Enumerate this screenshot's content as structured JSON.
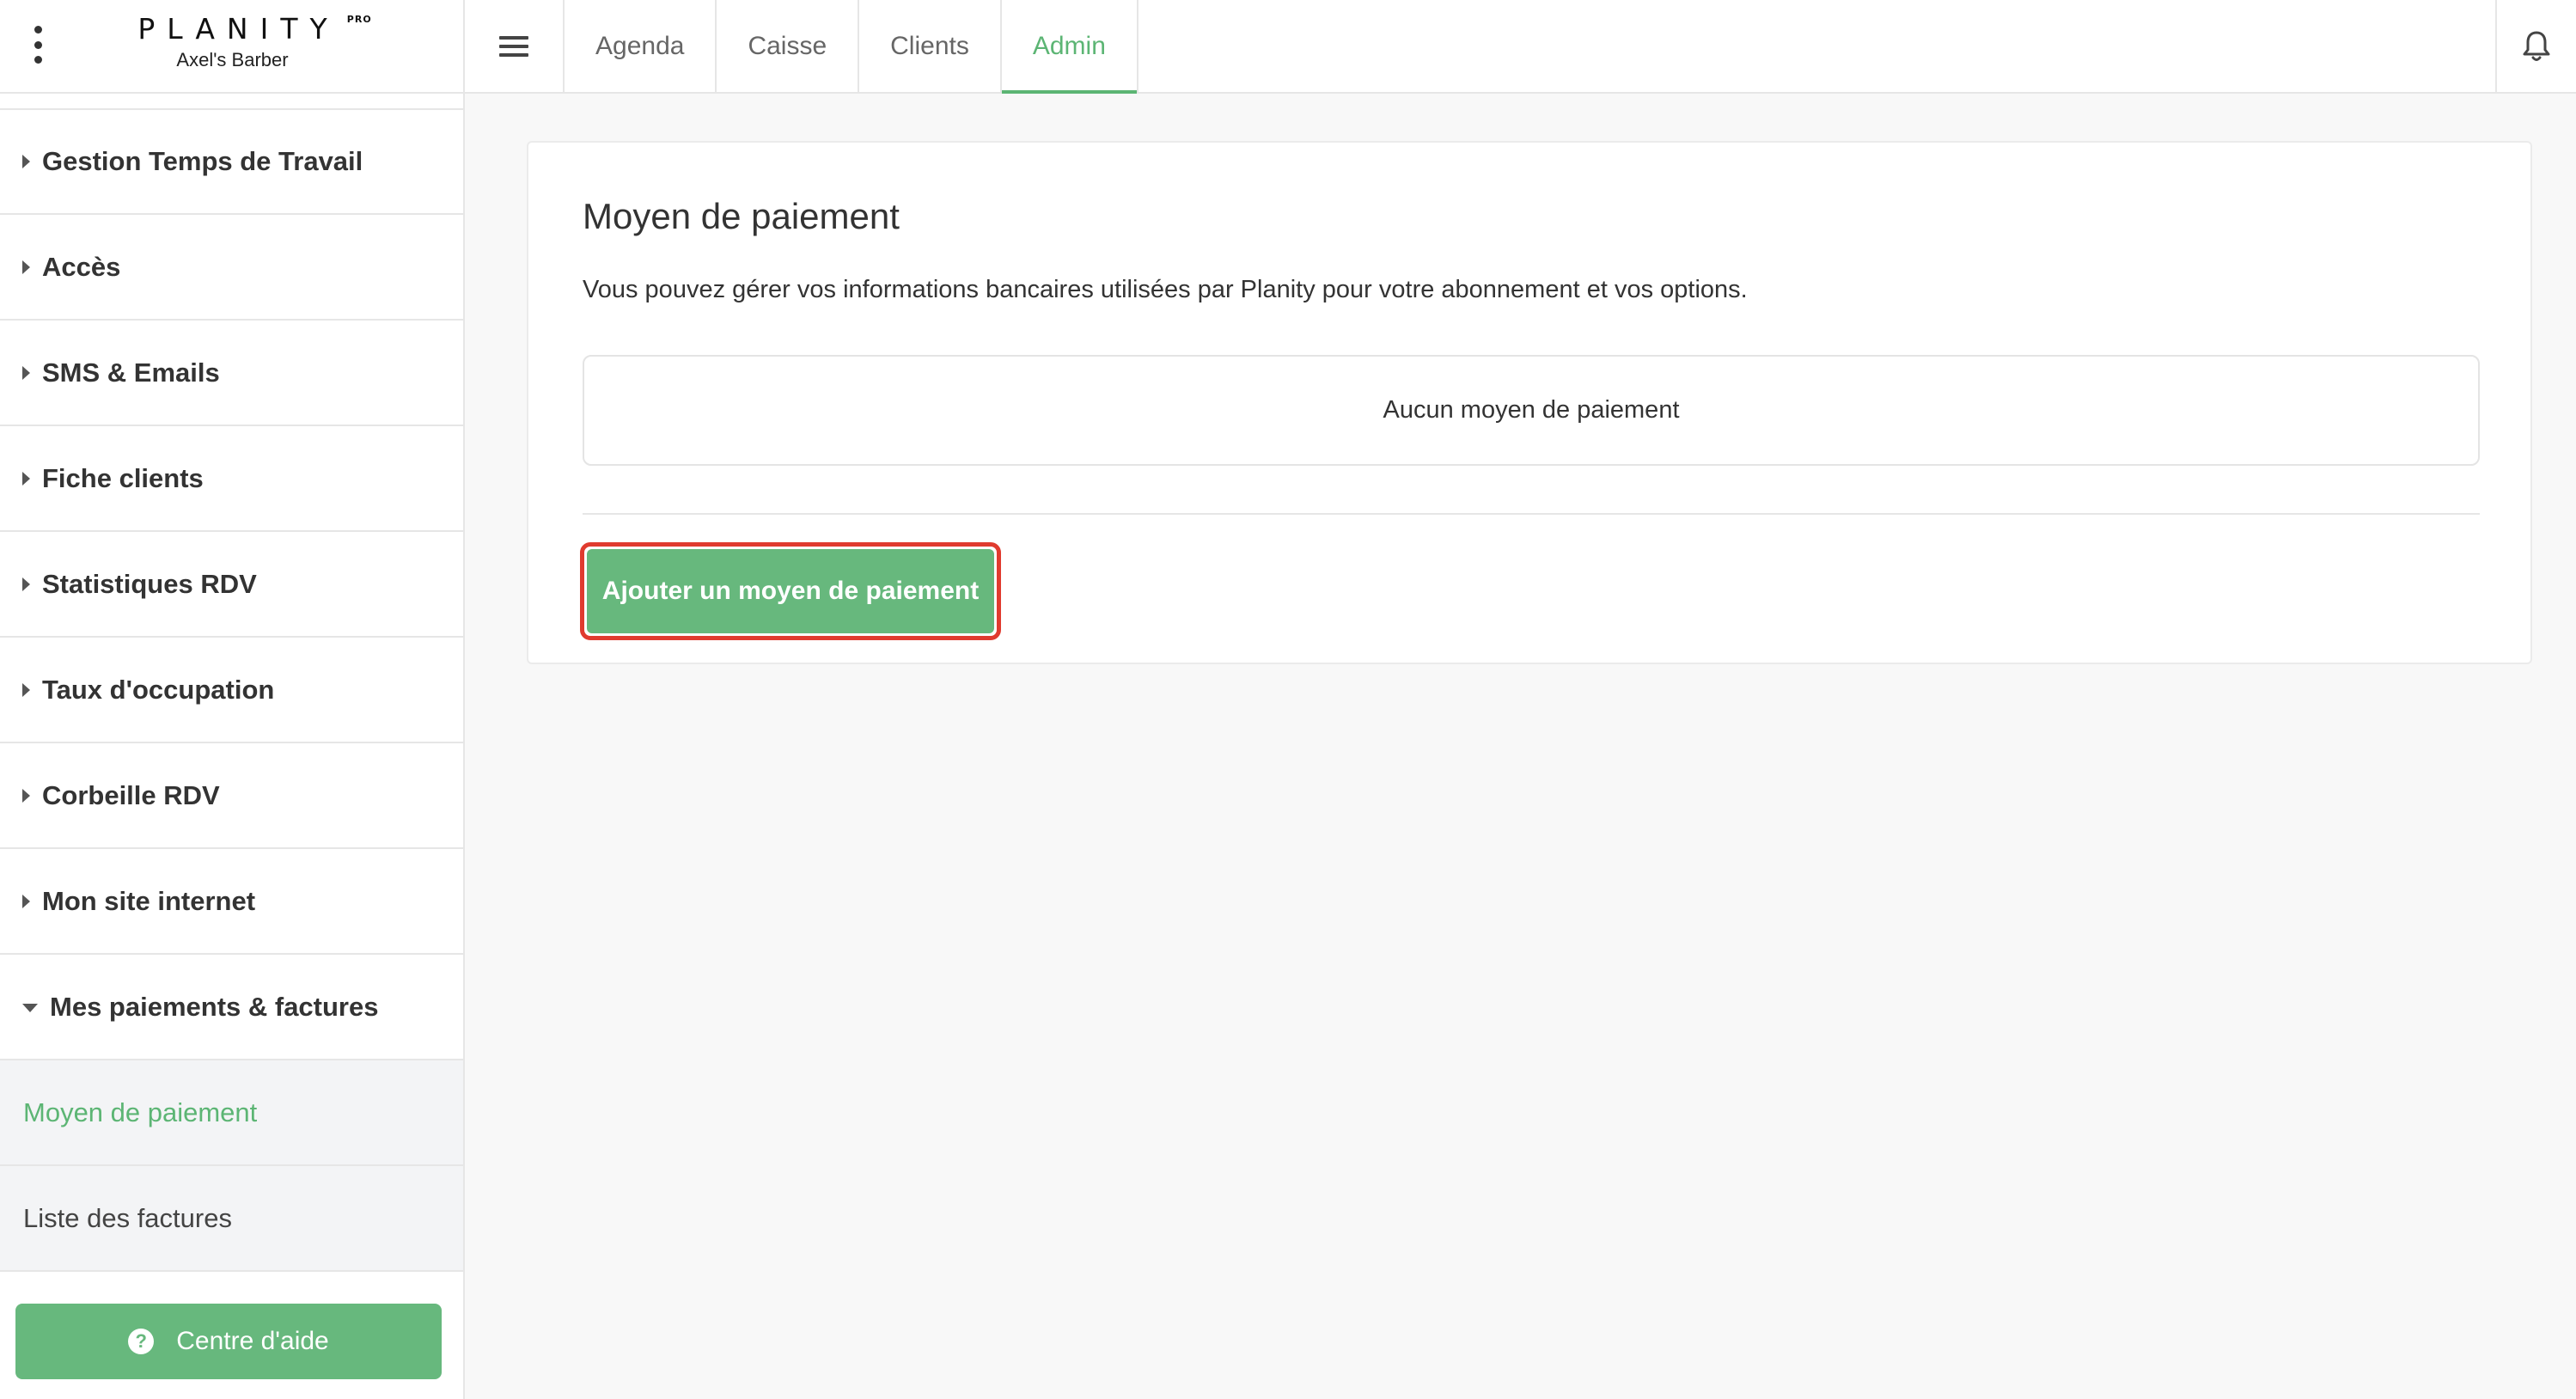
{
  "brand": {
    "logo_text": "PLANITY",
    "logo_badge": "PRO",
    "salon_name": "Axel's Barber"
  },
  "topbar": {
    "tabs": [
      {
        "label": "Agenda"
      },
      {
        "label": "Caisse"
      },
      {
        "label": "Clients"
      },
      {
        "label": "Admin",
        "active": true
      }
    ]
  },
  "sidebar": {
    "items": [
      {
        "label": "Gestion Temps de Travail"
      },
      {
        "label": "Accès"
      },
      {
        "label": "SMS & Emails"
      },
      {
        "label": "Fiche clients"
      },
      {
        "label": "Statistiques RDV"
      },
      {
        "label": "Taux d'occupation"
      },
      {
        "label": "Corbeille RDV"
      },
      {
        "label": "Mon site internet"
      },
      {
        "label": "Mes paiements & factures",
        "expanded": true
      }
    ],
    "subitems": [
      {
        "label": "Moyen de paiement",
        "active": true
      },
      {
        "label": "Liste des factures"
      }
    ],
    "help_label": "Centre d'aide"
  },
  "main": {
    "title": "Moyen de paiement",
    "description": "Vous pouvez gérer vos informations bancaires utilisées par Planity pour votre abonnement et vos options.",
    "empty_state": "Aucun moyen de paiement",
    "add_button_label": "Ajouter un moyen de paiement"
  },
  "colors": {
    "accent_green": "#67b87d",
    "active_text_green": "#5cb574",
    "highlight_red": "#e03b2f"
  }
}
